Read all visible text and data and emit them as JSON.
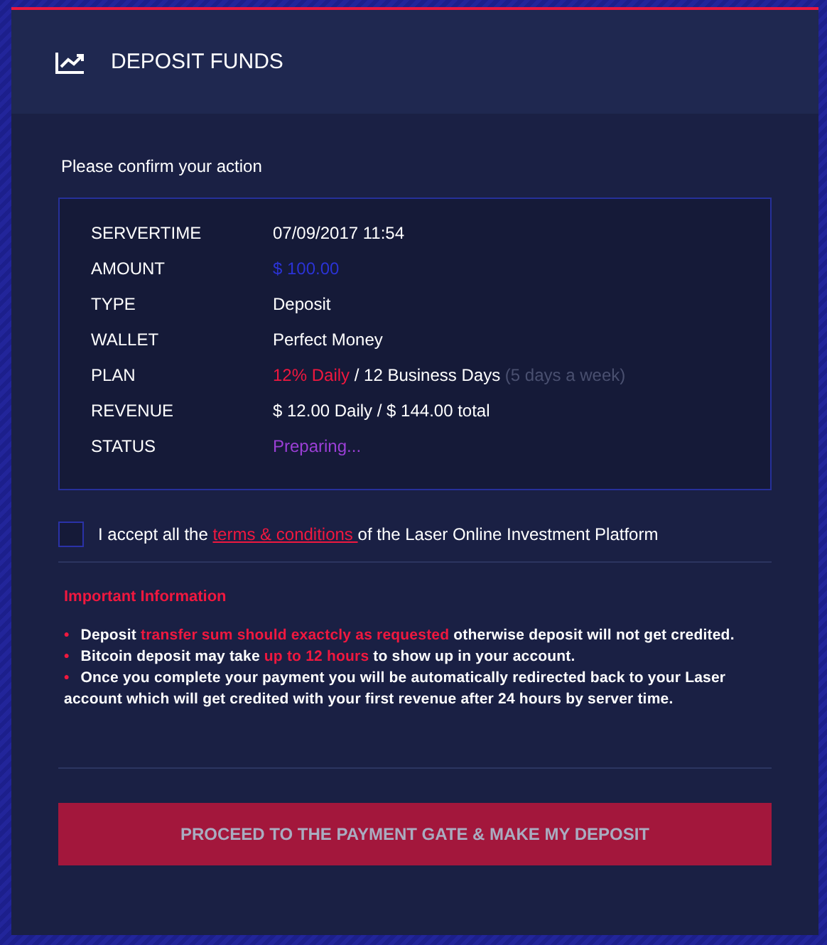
{
  "header": {
    "title": "DEPOSIT FUNDS"
  },
  "prompt": "Please confirm your action",
  "details": [
    {
      "label": "SERVERTIME",
      "value": [
        {
          "text": "07/09/2017 11:54",
          "kind": "plain"
        }
      ]
    },
    {
      "label": "AMOUNT",
      "value": [
        {
          "text": "$ 100.00",
          "kind": "amount"
        }
      ]
    },
    {
      "label": "TYPE",
      "value": [
        {
          "text": "Deposit",
          "kind": "plain"
        }
      ]
    },
    {
      "label": "WALLET",
      "value": [
        {
          "text": "Perfect Money",
          "kind": "plain"
        }
      ]
    },
    {
      "label": "PLAN",
      "value": [
        {
          "text": "12% Daily",
          "kind": "accent"
        },
        {
          "text": " / 12 Business Days ",
          "kind": "plain"
        },
        {
          "text": "(5 days a week)",
          "kind": "muted"
        }
      ]
    },
    {
      "label": "REVENUE",
      "value": [
        {
          "text": "$ 12.00 Daily / $ 144.00 total",
          "kind": "plain"
        }
      ]
    },
    {
      "label": "STATUS",
      "value": [
        {
          "text": "Preparing...",
          "kind": "status"
        }
      ]
    }
  ],
  "agreement": {
    "checked": false,
    "before": "I accept all the ",
    "link": "terms & conditions ",
    "after": "of the Laser Online Investment Platform"
  },
  "info": {
    "title": "Important Information",
    "bullets": [
      {
        "marker": "•",
        "parts": [
          {
            "text": "Deposit ",
            "kind": "plain"
          },
          {
            "text": "transfer sum should exactcly as requested",
            "kind": "accent"
          },
          {
            "text": " otherwise deposit will not get credited.",
            "kind": "plain"
          }
        ]
      },
      {
        "marker": "•",
        "parts": [
          {
            "text": "Bitcoin deposit may take ",
            "kind": "plain"
          },
          {
            "text": "up to 12 hours",
            "kind": "accent"
          },
          {
            "text": " to show up in your account.",
            "kind": "plain"
          }
        ]
      },
      {
        "marker": "•",
        "parts": [
          {
            "text": "Once you complete your payment you will be automatically redirected back to your Laser account which will get credited with your first revenue after 24 hours by server time.",
            "kind": "plain"
          }
        ]
      }
    ]
  },
  "submit": "PROCEED TO THE PAYMENT GATE & MAKE MY DEPOSIT"
}
